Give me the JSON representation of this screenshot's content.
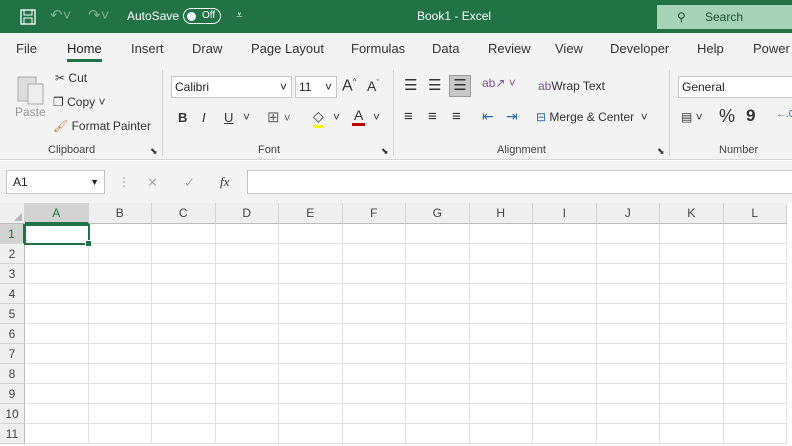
{
  "titlebar": {
    "autosave_label": "AutoSave",
    "autosave_state": "Off",
    "title": "Book1  -  Excel",
    "search_label": "Search"
  },
  "tabs": [
    "File",
    "Home",
    "Insert",
    "Draw",
    "Page Layout",
    "Formulas",
    "Data",
    "Review",
    "View",
    "Developer",
    "Help",
    "Power"
  ],
  "active_tab": "Home",
  "ribbon": {
    "clipboard": {
      "label": "Clipboard",
      "paste": "Paste",
      "cut": "Cut",
      "copy": "Copy",
      "format_painter": "Format Painter"
    },
    "font": {
      "label": "Font",
      "font_name": "Calibri",
      "font_size": "11",
      "bold": "B",
      "italic": "I",
      "underline": "U",
      "increase": "A",
      "decrease": "A",
      "font_color": "A",
      "highlight_color": "#ffff00",
      "font_color_value": "#c00000"
    },
    "alignment": {
      "label": "Alignment",
      "wrap_text": "Wrap Text",
      "merge_center": "Merge & Center"
    },
    "number": {
      "label": "Number",
      "format": "General",
      "percent": "%",
      "comma": "9"
    }
  },
  "formula_bar": {
    "name_box": "A1",
    "fx": "fx",
    "cancel": "✕",
    "enter": "✓",
    "value": ""
  },
  "columns": [
    "A",
    "B",
    "C",
    "D",
    "E",
    "F",
    "G",
    "H",
    "I",
    "J",
    "K",
    "L"
  ],
  "rows": [
    "1",
    "2",
    "3",
    "4",
    "5",
    "6",
    "7",
    "8",
    "9",
    "10",
    "11"
  ],
  "active_cell": "A1",
  "colors": {
    "accent": "#217346"
  }
}
